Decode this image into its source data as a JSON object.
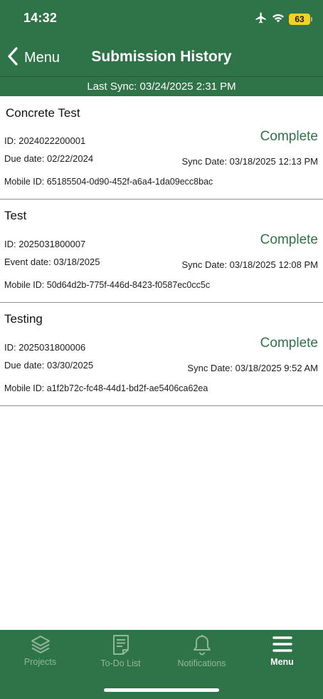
{
  "status_bar": {
    "time": "14:32",
    "battery": "63"
  },
  "nav": {
    "back_label": "Menu",
    "title": "Submission History"
  },
  "sync": {
    "text": "Last Sync: 03/24/2025 2:31 PM"
  },
  "submissions": [
    {
      "title": "Concrete Test",
      "status": "Complete",
      "id": "ID: 2024022200001",
      "date": "Due date: 02/22/2024",
      "sync_date": "Sync Date: 03/18/2025 12:13 PM",
      "mobile_id": "Mobile ID: 65185504-0d90-452f-a6a4-1da09ecc8bac"
    },
    {
      "title": "Test",
      "status": "Complete",
      "id": "ID: 2025031800007",
      "date": "Event date: 03/18/2025",
      "sync_date": "Sync Date: 03/18/2025 12:08 PM",
      "mobile_id": "Mobile ID: 50d64d2b-775f-446d-8423-f0587ec0cc5c"
    },
    {
      "title": "Testing",
      "status": "Complete",
      "id": "ID: 2025031800006",
      "date": "Due date: 03/30/2025",
      "sync_date": "Sync Date: 03/18/2025 9:52 AM",
      "mobile_id": "Mobile ID: a1f2b72c-fc48-44d1-bd2f-ae5406ca62ea"
    }
  ],
  "tabs": [
    {
      "label": "Projects",
      "icon": "layers-icon",
      "active": false
    },
    {
      "label": "To-Do List",
      "icon": "checklist-document-icon",
      "active": false
    },
    {
      "label": "Notifications",
      "icon": "bell-icon",
      "active": false
    },
    {
      "label": "Menu",
      "icon": "hamburger-menu-icon",
      "active": true
    }
  ],
  "colors": {
    "brand_green": "#2f7348",
    "status_complete": "#2f7348",
    "inactive_tab": "#8fb89c",
    "battery": "#f4d21f"
  }
}
